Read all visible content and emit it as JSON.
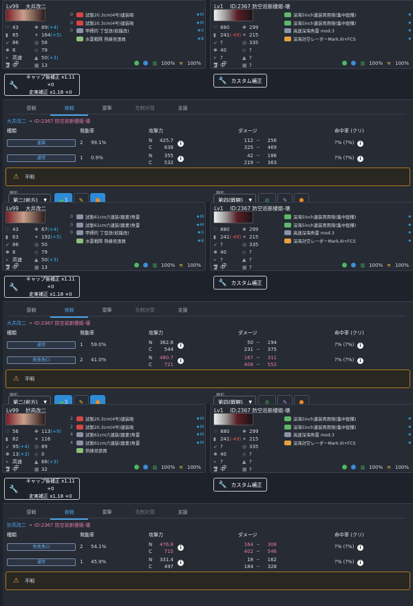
{
  "blocks": [
    {
      "friend": {
        "level": "Lv99",
        "name": "大井改二",
        "stats": [
          {
            "icon": "hp-icon",
            "a": "43",
            "b": "89",
            "b2": "(+4)"
          },
          {
            "icon": "armor-icon",
            "a": "65",
            "b": "164",
            "b2": "(+5)"
          },
          {
            "icon": "evasion-icon",
            "a": "86",
            "b": "58"
          },
          {
            "icon": "aircraft-icon",
            "a": "8",
            "b": "79"
          },
          {
            "icon": "speed-icon",
            "a": "高速",
            "b": "50",
            "b2": "(+3)"
          },
          {
            "icon": "range-icon",
            "a": "中",
            "b": "13"
          }
        ],
        "equipment": [
          {
            "slot": "0",
            "name": "試製20.3cm(4号)連装砲",
            "mark": "★M",
            "color": "#d94545"
          },
          {
            "slot": "0",
            "name": "試製20.3cm(4号)連装砲",
            "mark": "★M",
            "color": "#d94545"
          },
          {
            "slot": "0",
            "name": "甲標的 丁型改(蛟龍改)",
            "mark": "★0",
            "color": "#8a94a8"
          },
          {
            "slot": "",
            "name": "水雷戦隊 熟練見張員",
            "mark": "★8",
            "color": "#8ec07a"
          }
        ],
        "footer": {
          "fuel": "100%",
          "ammo": "100%"
        }
      },
      "enemy": {
        "level": "Lv1",
        "name": "ID:2367 防空巡新棲姫-壊",
        "stats": [
          {
            "icon": "hp-icon",
            "a": "880",
            "b": "299"
          },
          {
            "icon": "armor-icon",
            "a": "241",
            "a2": "(-49)",
            "b": "215"
          },
          {
            "icon": "evasion-icon",
            "a": "?",
            "b": "335"
          },
          {
            "icon": "aircraft-icon",
            "a": "40",
            "b": "?"
          },
          {
            "icon": "speed-icon",
            "a": "?",
            "b": "?"
          },
          {
            "icon": "range-icon",
            "a": "中",
            "b": "?"
          }
        ],
        "equipment": [
          {
            "slot": "",
            "name": "深海5inch連装両用砲(集中配備)",
            "mark": "★",
            "color": "#5fb86a"
          },
          {
            "slot": "",
            "name": "深海5inch連装両用砲(集中配備)",
            "mark": "★",
            "color": "#5fb86a"
          },
          {
            "slot": "",
            "name": "高速深海魚雷 mod.3",
            "mark": "★",
            "color": "#8a94a8"
          },
          {
            "slot": "",
            "name": "深海対空レーダーMark.III+FCS",
            "mark": "★",
            "color": "#e6a040"
          }
        ],
        "footer": {
          "fuel": "100%",
          "ammo": "100%"
        }
      },
      "cap_button": {
        "line1": "キャップ後補正 x1.11 +0",
        "line2": "史実補正 x1.18 +0"
      },
      "custom_button": "カスタム補正",
      "tabs": [
        "昼戦",
        "夜戦",
        "雷撃",
        "先制対潜",
        "支援"
      ],
      "target": {
        "from": "大井改二",
        "arrow": "→",
        "to": "ID:2367 防空巡新棲姫-壊"
      },
      "headers": {
        "kind": "種類",
        "rate": "発動率",
        "power": "攻撃力",
        "damage": "ダメージ",
        "hit": "命中率 (クリ)"
      },
      "rows": [
        {
          "type": "連撃",
          "count": "2",
          "rate": "99.1%",
          "n": "425.7",
          "c": "638",
          "nlo": "112",
          "nhi": "256",
          "clo": "325",
          "chi": "469",
          "hit": "?%",
          "crit": "(?%)",
          "pc": false,
          "dc": false
        },
        {
          "type": "通常",
          "count": "1",
          "rate": "0.9%",
          "n": "355",
          "c": "532",
          "nlo": "42",
          "nhi": "186",
          "clo": "219",
          "chi": "363",
          "hit": "?%",
          "crit": "(?%)",
          "pc": false,
          "dc": false
        }
      ],
      "warning": "不明",
      "formation": {
        "label_l": "陣形",
        "value_l": "第二(前方)",
        "count": "3",
        "label_r": "陣形",
        "value_r": "第四(戦闘)"
      }
    },
    {
      "friend": {
        "level": "Lv99",
        "name": "大井改二",
        "stats": [
          {
            "icon": "hp-icon",
            "a": "43",
            "b": "67",
            "b2": "(+4)"
          },
          {
            "icon": "armor-icon",
            "a": "63",
            "b": "192",
            "b2": "(+5)"
          },
          {
            "icon": "evasion-icon",
            "a": "86",
            "b": "50"
          },
          {
            "icon": "aircraft-icon",
            "a": "8",
            "b": "79"
          },
          {
            "icon": "speed-icon",
            "a": "高速",
            "b": "50",
            "b2": "(+3)"
          },
          {
            "icon": "range-icon",
            "a": "中",
            "b": "13"
          }
        ],
        "equipment": [
          {
            "slot": "0",
            "name": "試製61cm六連装(酸素)魚雷",
            "mark": "★M",
            "color": "#8a94a8"
          },
          {
            "slot": "0",
            "name": "試製61cm六連装(酸素)魚雷",
            "mark": "★M",
            "color": "#8a94a8"
          },
          {
            "slot": "0",
            "name": "甲標的 丁型改(蛟龍改)",
            "mark": "★0",
            "color": "#8a94a8"
          },
          {
            "slot": "",
            "name": "水雷戦隊 熟練見張員",
            "mark": "★8",
            "color": "#8ec07a"
          }
        ],
        "footer": {
          "fuel": "100%",
          "ammo": "100%"
        }
      },
      "enemy": {
        "level": "Lv1",
        "name": "ID:2367 防空巡新棲姫-壊",
        "stats": [
          {
            "icon": "hp-icon",
            "a": "880",
            "b": "299"
          },
          {
            "icon": "armor-icon",
            "a": "241",
            "a2": "(-49)",
            "b": "215"
          },
          {
            "icon": "evasion-icon",
            "a": "?",
            "b": "335"
          },
          {
            "icon": "aircraft-icon",
            "a": "40",
            "b": "?"
          },
          {
            "icon": "speed-icon",
            "a": "?",
            "b": "?"
          },
          {
            "icon": "range-icon",
            "a": "中",
            "b": "?"
          }
        ],
        "equipment": [
          {
            "slot": "",
            "name": "深海5inch連装両用砲(集中配備)",
            "mark": "★",
            "color": "#5fb86a"
          },
          {
            "slot": "",
            "name": "深海5inch連装両用砲(集中配備)",
            "mark": "★",
            "color": "#5fb86a"
          },
          {
            "slot": "",
            "name": "高速深海魚雷 mod.3",
            "mark": "★",
            "color": "#8a94a8"
          },
          {
            "slot": "",
            "name": "深海対空レーダーMark.III+FCS",
            "mark": "★",
            "color": "#e6a040"
          }
        ],
        "footer": {
          "fuel": "100%",
          "ammo": "100%"
        }
      },
      "cap_button": {
        "line1": "キャップ後補正 x1.11 +0",
        "line2": "史実補正 x1.18 +0"
      },
      "custom_button": "カスタム補正",
      "tabs": [
        "昼戦",
        "夜戦",
        "雷撃",
        "先制対潜",
        "支援"
      ],
      "target": {
        "from": "大井改二",
        "arrow": "→",
        "to": "ID:2367 防空巡新棲姫-壊"
      },
      "headers": {
        "kind": "種類",
        "rate": "発動率",
        "power": "攻撃力",
        "damage": "ダメージ",
        "hit": "命中率 (クリ)"
      },
      "rows": [
        {
          "type": "通常",
          "count": "1",
          "rate": "59.0%",
          "n": "362.8",
          "c": "544",
          "nlo": "50",
          "nhi": "194",
          "clo": "231",
          "chi": "375",
          "hit": "?%",
          "crit": "(?%)",
          "pc": false,
          "dc": false
        },
        {
          "type": "魚魚魚CI",
          "count": "2",
          "rate": "41.0%",
          "n": "480.7",
          "c": "721",
          "nlo": "167",
          "nhi": "311",
          "clo": "408",
          "chi": "552",
          "hit": "?%",
          "crit": "(?%)",
          "pc": true,
          "dc": true
        }
      ],
      "warning": "不明",
      "formation": {
        "label_l": "陣形",
        "value_l": "第二(前方)",
        "count": "3",
        "label_r": "陣形",
        "value_r": "第四(戦闘)"
      }
    },
    {
      "friend": {
        "level": "Lv99",
        "name": "妙高改二",
        "stats": [
          {
            "icon": "hp-icon",
            "a": "56",
            "b": "113",
            "b2": "(+9)"
          },
          {
            "icon": "armor-icon",
            "a": "82",
            "b": "116"
          },
          {
            "icon": "evasion-icon",
            "a": "95",
            "a2": "(+4)",
            "b": "89"
          },
          {
            "icon": "aircraft-icon",
            "a": "13",
            "a2": "(+3)",
            "b": "0"
          },
          {
            "icon": "speed-icon",
            "a": "高速",
            "b": "66",
            "b2": "(+3)"
          },
          {
            "icon": "range-icon",
            "a": "中",
            "b": "32"
          }
        ],
        "equipment": [
          {
            "slot": "2",
            "name": "試製20.3cm(4号)連装砲",
            "mark": "★M",
            "color": "#d94545"
          },
          {
            "slot": "2",
            "name": "試製20.3cm(4号)連装砲",
            "mark": "★M",
            "color": "#d94545"
          },
          {
            "slot": "4",
            "name": "試製61cm六連装(酸素)魚雷",
            "mark": "★M",
            "color": "#8a94a8"
          },
          {
            "slot": "4",
            "name": "試製61cm六連装(酸素)魚雷",
            "mark": "★M",
            "color": "#8a94a8"
          },
          {
            "slot": "",
            "name": "熟練見張員",
            "mark": "",
            "color": "#8ec07a"
          }
        ],
        "footer": {
          "fuel": "100%",
          "ammo": "100%"
        }
      },
      "enemy": {
        "level": "Lv1",
        "name": "ID:2367 防空巡新棲姫-壊",
        "stats": [
          {
            "icon": "hp-icon",
            "a": "880",
            "b": "299"
          },
          {
            "icon": "armor-icon",
            "a": "241",
            "a2": "(-49)",
            "b": "215"
          },
          {
            "icon": "evasion-icon",
            "a": "?",
            "b": "335"
          },
          {
            "icon": "aircraft-icon",
            "a": "40",
            "b": "?"
          },
          {
            "icon": "speed-icon",
            "a": "?",
            "b": "?"
          },
          {
            "icon": "range-icon",
            "a": "中",
            "b": "?"
          }
        ],
        "equipment": [
          {
            "slot": "",
            "name": "深海5inch連装両用砲(集中配備)",
            "mark": "★",
            "color": "#5fb86a"
          },
          {
            "slot": "",
            "name": "深海5inch連装両用砲(集中配備)",
            "mark": "★",
            "color": "#5fb86a"
          },
          {
            "slot": "",
            "name": "高速深海魚雷 mod.3",
            "mark": "★",
            "color": "#8a94a8"
          },
          {
            "slot": "",
            "name": "深海対空レーダーMark.III+FCS",
            "mark": "★",
            "color": "#e6a040"
          }
        ],
        "footer": {
          "fuel": "100%",
          "ammo": "100%"
        }
      },
      "cap_button": {
        "line1": "キャップ後補正 x1.11 +0",
        "line2": "史実補正 x1.18 +0"
      },
      "custom_button": "カスタム補正",
      "tabs": [
        "昼戦",
        "夜戦",
        "雷撃",
        "先制対潜",
        "支援"
      ],
      "target": {
        "from": "妙高改二",
        "arrow": "→",
        "to": "ID:2367 防空巡新棲姫-壊"
      },
      "headers": {
        "kind": "種類",
        "rate": "発動率",
        "power": "攻撃力",
        "damage": "ダメージ",
        "hit": "命中率 (クリ)"
      },
      "rows": [
        {
          "type": "魚魚魚CI",
          "count": "2",
          "rate": "54.1%",
          "n": "476.8",
          "c": "715",
          "nlo": "164",
          "nhi": "308",
          "clo": "402",
          "chi": "546",
          "hit": "?%",
          "crit": "(?%)",
          "pc": true,
          "dc": true
        },
        {
          "type": "通常",
          "count": "1",
          "rate": "45.9%",
          "n": "331.4",
          "c": "497",
          "nlo": "18",
          "nhi": "162",
          "clo": "184",
          "chi": "328",
          "hit": "?%",
          "crit": "(?%)",
          "pc": false,
          "dc": false
        }
      ],
      "warning": "不明",
      "formation": null
    }
  ]
}
